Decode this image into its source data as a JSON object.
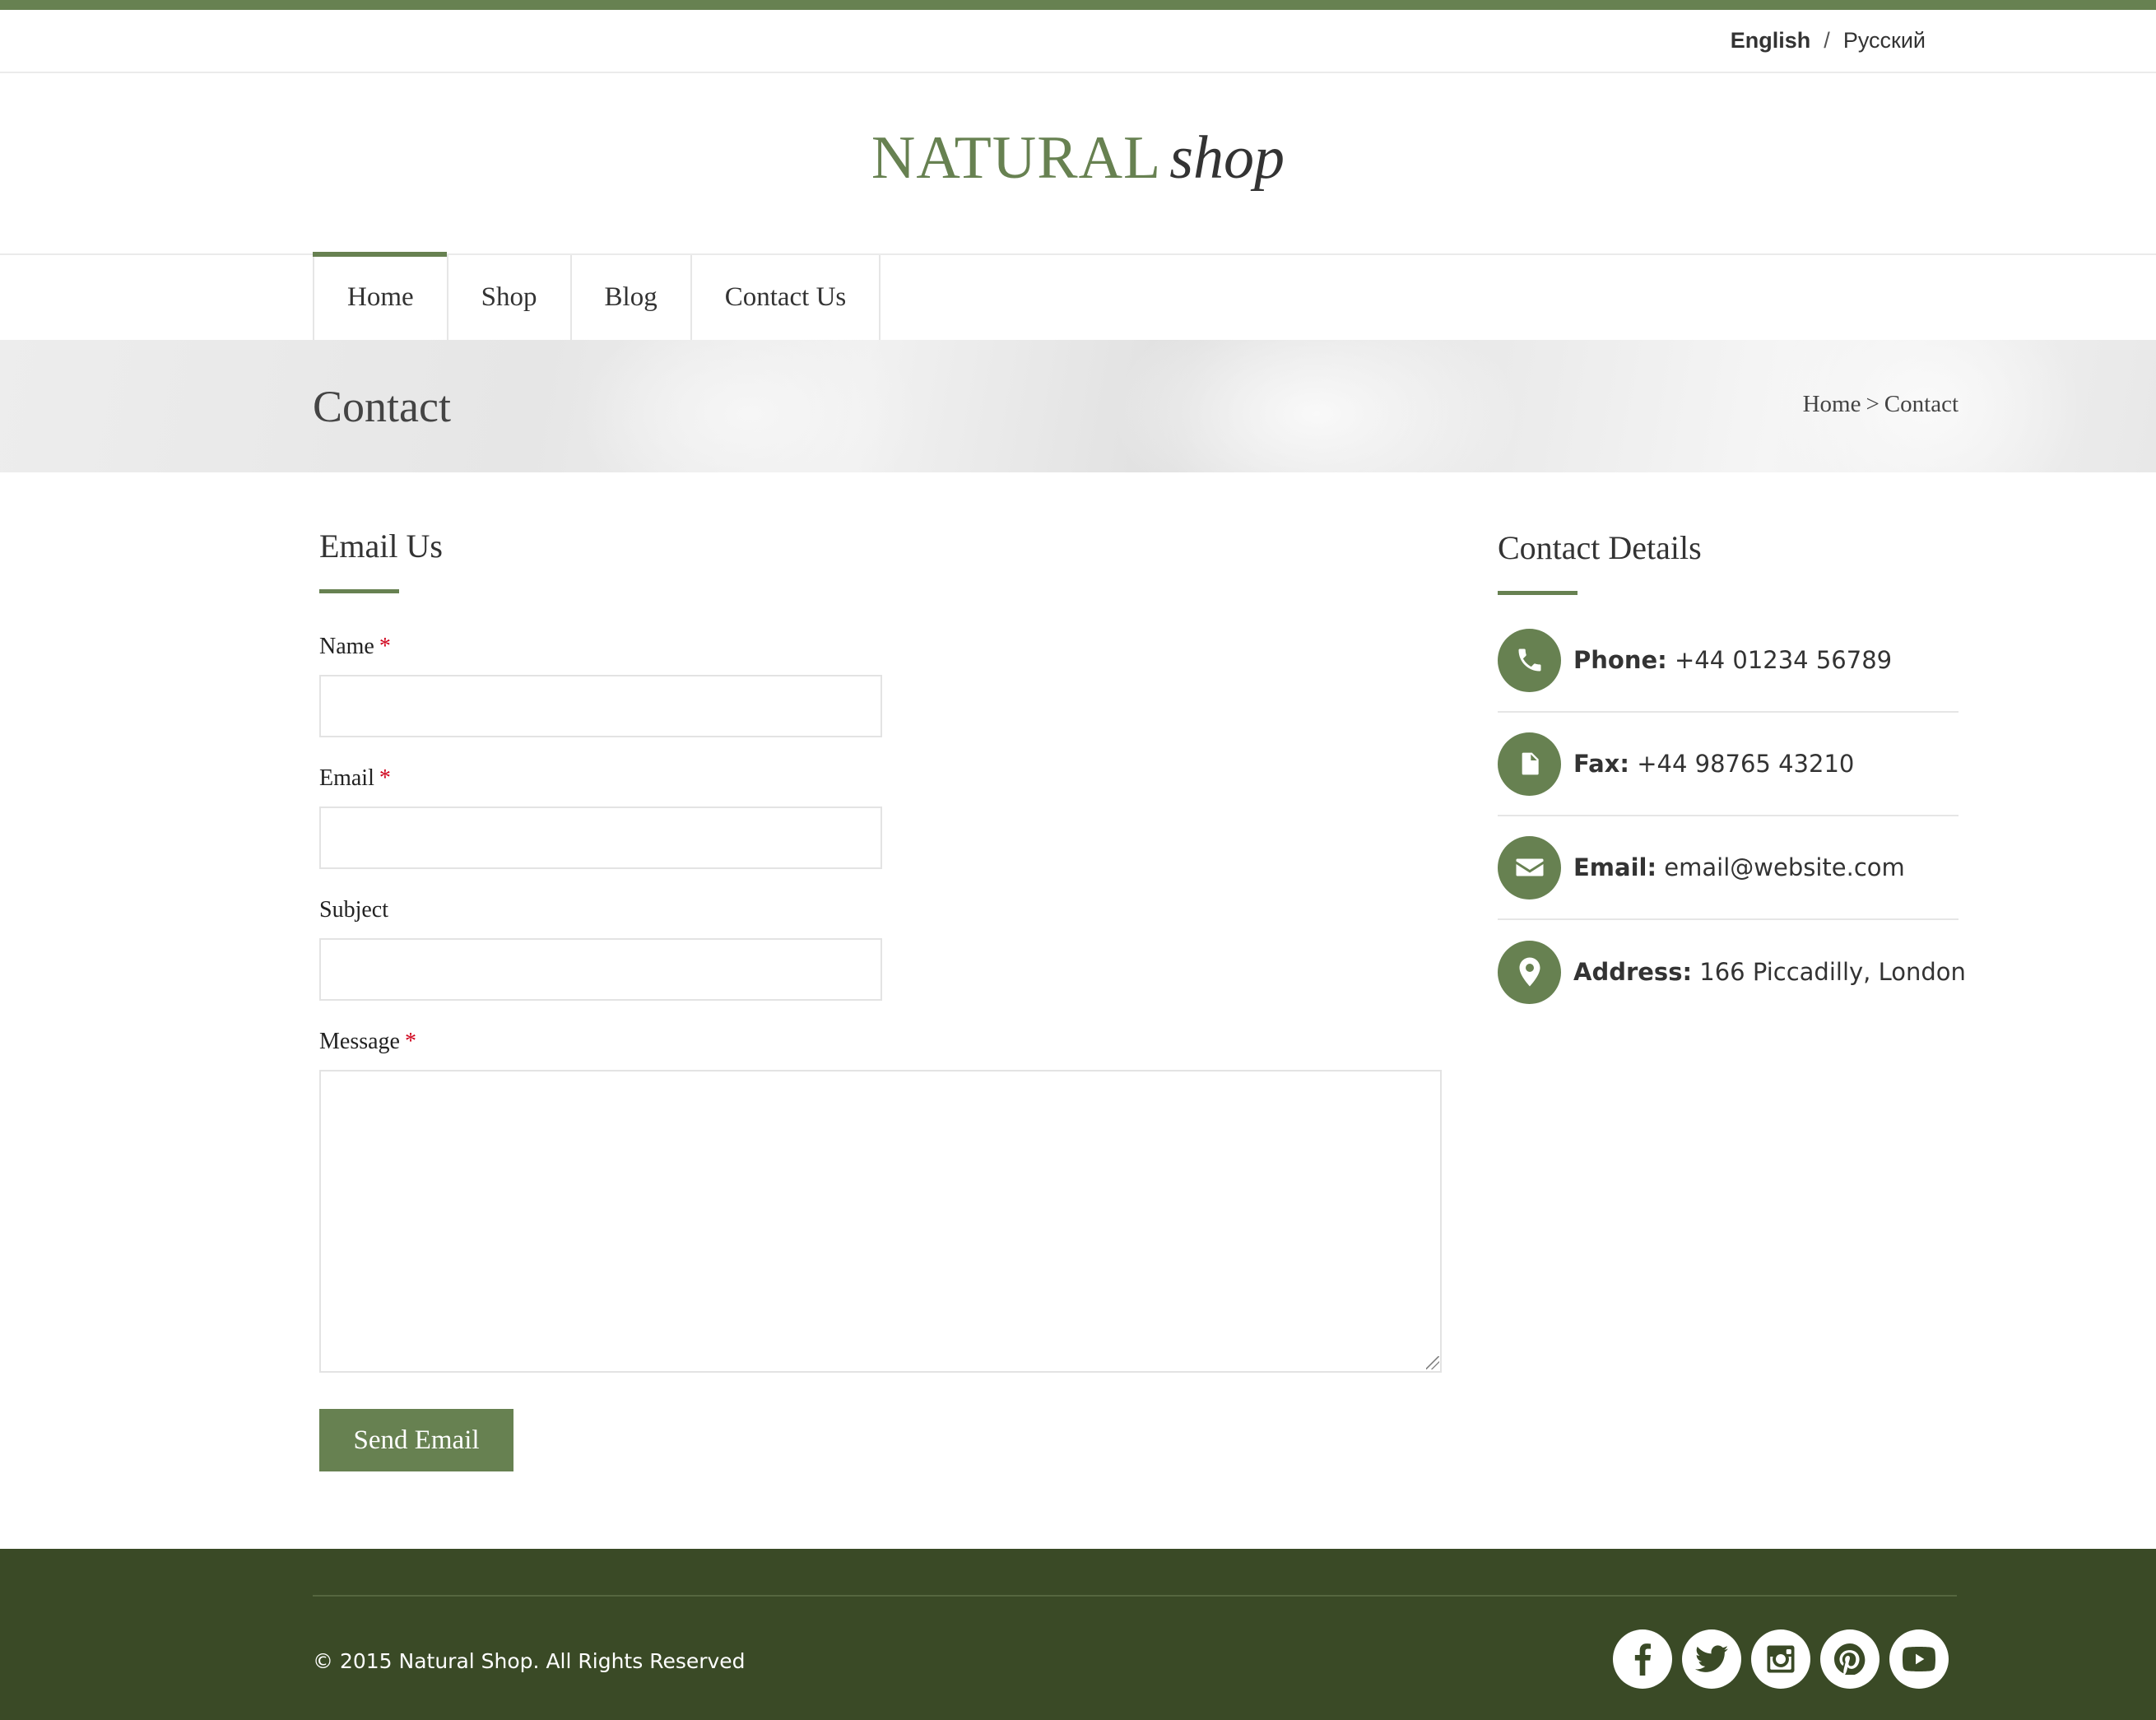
{
  "languages": {
    "active": "English",
    "separator": "/",
    "other": "Русский"
  },
  "logo": {
    "primary": "NATURAL",
    "secondary": "shop"
  },
  "nav": {
    "items": [
      {
        "label": "Home",
        "active": true
      },
      {
        "label": "Shop",
        "active": false
      },
      {
        "label": "Blog",
        "active": false
      },
      {
        "label": "Contact Us",
        "active": false
      }
    ]
  },
  "banner": {
    "title": "Contact",
    "breadcrumb": {
      "home": "Home",
      "separator": ">",
      "current": "Contact"
    }
  },
  "email_form": {
    "title": "Email Us",
    "fields": {
      "name": {
        "label": "Name",
        "required": "*",
        "value": ""
      },
      "email": {
        "label": "Email",
        "required": "*",
        "value": ""
      },
      "subject": {
        "label": "Subject",
        "value": ""
      },
      "message": {
        "label": "Message",
        "required": "*",
        "value": ""
      }
    },
    "submit_label": "Send Email"
  },
  "contact_details": {
    "title": "Contact Details",
    "items": [
      {
        "icon": "phone-icon",
        "label": "Phone:",
        "value": "+44 01234 56789"
      },
      {
        "icon": "file-icon",
        "label": "Fax:",
        "value": "+44 98765 43210"
      },
      {
        "icon": "envelope-icon",
        "label": "Email:",
        "value": "email@website.com"
      },
      {
        "icon": "map-pin-icon",
        "label": "Address:",
        "value": "166 Piccadilly, London"
      }
    ]
  },
  "footer": {
    "copyright": "© 2015 Natural Shop. All Rights Reserved",
    "social": [
      "facebook-icon",
      "twitter-icon",
      "instagram-icon",
      "pinterest-icon",
      "youtube-icon"
    ]
  },
  "colors": {
    "accent": "#678151",
    "footer_bg": "#3a4a26",
    "required": "#d0021b"
  }
}
